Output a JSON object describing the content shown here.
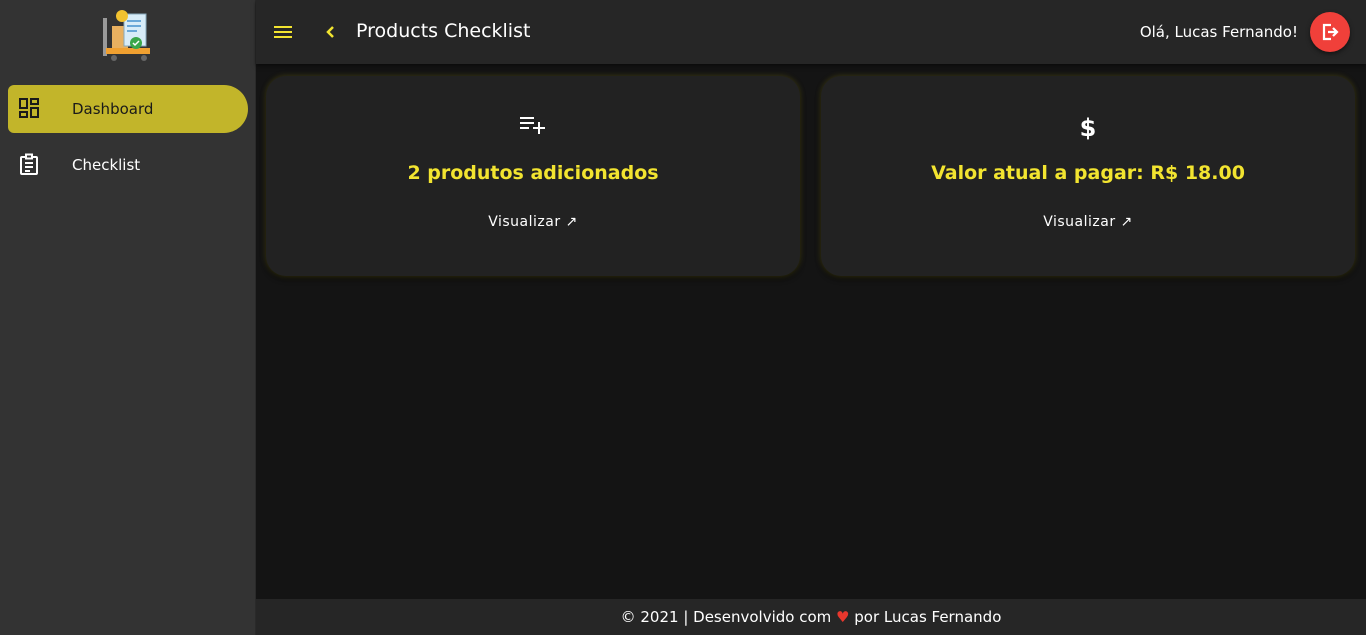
{
  "sidebar": {
    "items": [
      {
        "label": "Dashboard",
        "icon": "dashboard-icon",
        "active": true
      },
      {
        "label": "Checklist",
        "icon": "clipboard-icon",
        "active": false
      }
    ]
  },
  "header": {
    "title": "Products Checklist",
    "greeting": "Olá, Lucas Fernando!"
  },
  "cards": [
    {
      "icon": "playlist-add-icon",
      "title": "2 produtos adicionados",
      "link": "Visualizar"
    },
    {
      "icon": "dollar-icon",
      "title": "Valor atual a pagar: R$ 18.00",
      "link": "Visualizar"
    }
  ],
  "footer": {
    "prefix": "© 2021 | Desenvolvido com",
    "heart": "♥",
    "suffix": "por Lucas Fernando"
  },
  "colors": {
    "accent": "#c2b52a",
    "highlight_text": "#f2e430",
    "logout": "#f0403a",
    "background": "#141414"
  }
}
